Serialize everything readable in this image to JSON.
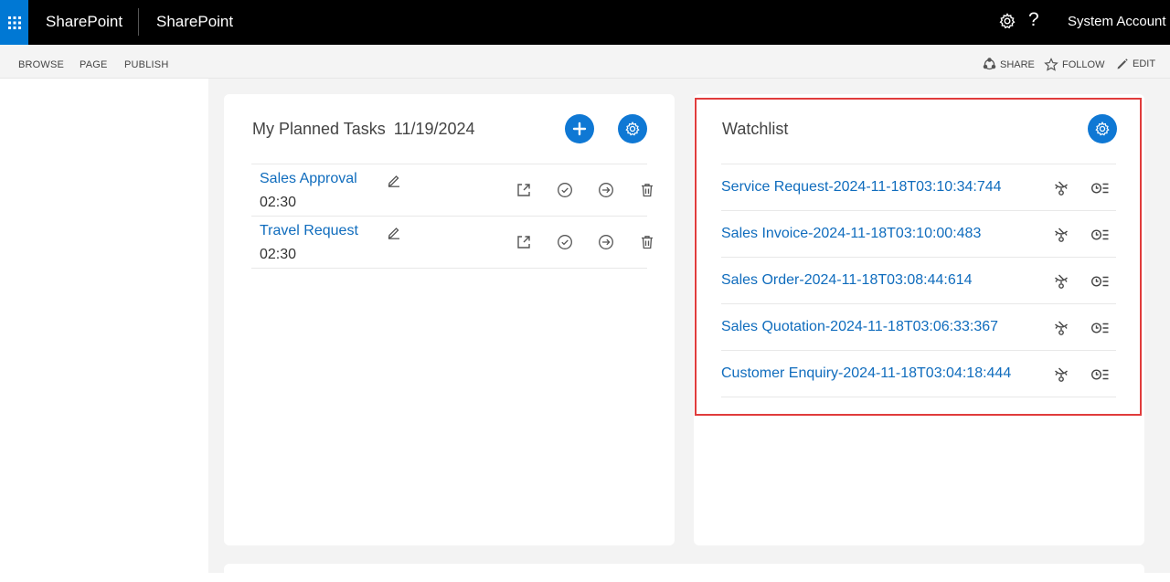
{
  "suitebar": {
    "brand": "SharePoint",
    "site": "SharePoint",
    "help": "?",
    "user": "System Account",
    "icons": [
      "waffle-icon",
      "gear-icon",
      "help-icon"
    ]
  },
  "ribbon": {
    "tabs": [
      "BROWSE",
      "PAGE",
      "PUBLISH"
    ],
    "actions": [
      {
        "label": "SHARE",
        "icon": "share-icon"
      },
      {
        "label": "FOLLOW",
        "icon": "star-icon"
      },
      {
        "label": "EDIT",
        "icon": "pencil-icon"
      }
    ]
  },
  "tasks": {
    "title": "My Planned Tasks",
    "date": "11/19/2024",
    "items": [
      {
        "name": "Sales Approval",
        "time": "02:30"
      },
      {
        "name": "Travel Request",
        "time": "02:30"
      }
    ],
    "row_icons": [
      "edit-icon",
      "open-external-icon",
      "complete-icon",
      "forward-icon",
      "delete-icon"
    ]
  },
  "watchlist": {
    "title": "Watchlist",
    "items": [
      {
        "name": "Service Request-2024-11-18T03:10:34:744"
      },
      {
        "name": "Sales Invoice-2024-11-18T03:10:00:483"
      },
      {
        "name": "Sales Order-2024-11-18T03:08:44:614"
      },
      {
        "name": "Sales Quotation-2024-11-18T03:06:33:367"
      },
      {
        "name": "Customer Enquiry-2024-11-18T03:04:18:444"
      }
    ],
    "row_icons": [
      "unwatch-icon",
      "history-icon"
    ]
  },
  "colors": {
    "accent": "#0f78d4",
    "link": "#0f6cbd",
    "highlight_border": "#e03c3c",
    "suitebar": "#000000"
  }
}
